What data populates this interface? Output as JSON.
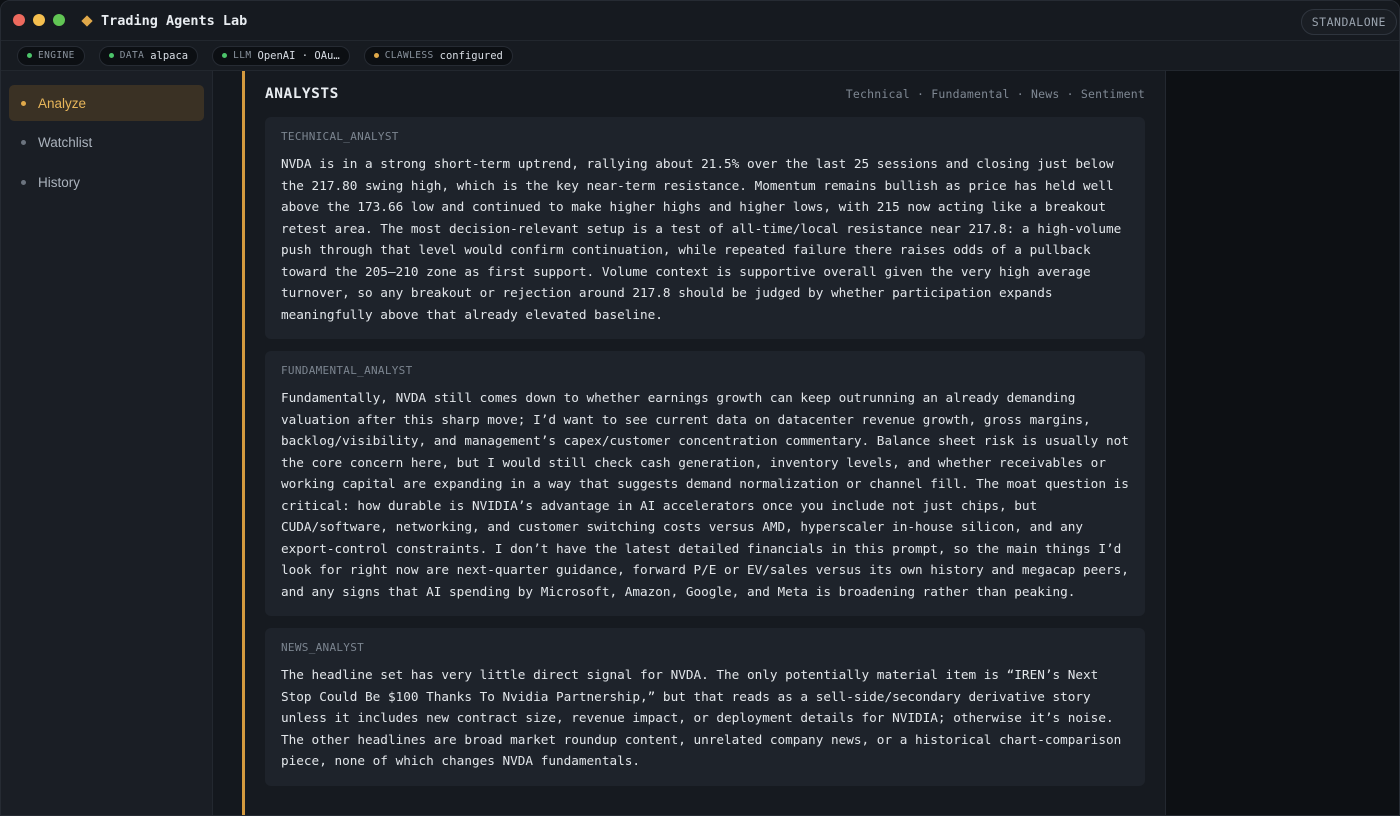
{
  "window": {
    "title": "Trading Agents Lab",
    "mode": "STANDALONE"
  },
  "status": [
    {
      "key": "ENGINE",
      "value": "",
      "dot_color": "#4cc46a"
    },
    {
      "key": "DATA",
      "value": "alpaca",
      "dot_color": "#4cc46a"
    },
    {
      "key": "LLM",
      "value": "OpenAI · OAu…",
      "dot_color": "#4cc46a"
    },
    {
      "key": "CLAWLESS",
      "value": "configured",
      "dot_color": "#e0a94a"
    }
  ],
  "sidebar": {
    "items": [
      {
        "label": "Analyze",
        "active": true
      },
      {
        "label": "Watchlist",
        "active": false
      },
      {
        "label": "History",
        "active": false
      }
    ]
  },
  "main": {
    "title": "ANALYSTS",
    "filters": "Technical · Fundamental · News · Sentiment",
    "cards": [
      {
        "label": "TECHNICAL_ANALYST",
        "text": "NVDA is in a strong short-term uptrend, rallying about 21.5% over the last 25 sessions and closing just below the 217.80 swing high, which is the key near-term resistance. Momentum remains bullish as price has held well above the 173.66 low and continued to make higher highs and higher lows, with 215 now acting like a breakout retest area. The most decision-relevant setup is a test of all-time/local resistance near 217.8: a high-volume push through that level would confirm continuation, while repeated failure there raises odds of a pullback toward the 205–210 zone as first support. Volume context is supportive overall given the very high average turnover, so any breakout or rejection around 217.8 should be judged by whether participation expands meaningfully above that already elevated baseline."
      },
      {
        "label": "FUNDAMENTAL_ANALYST",
        "text": "Fundamentally, NVDA still comes down to whether earnings growth can keep outrunning an already demanding valuation after this sharp move; I’d want to see current data on datacenter revenue growth, gross margins, backlog/visibility, and management’s capex/customer concentration commentary. Balance sheet risk is usually not the core concern here, but I would still check cash generation, inventory levels, and whether receivables or working capital are expanding in a way that suggests demand normalization or channel fill. The moat question is critical: how durable is NVIDIA’s advantage in AI accelerators once you include not just chips, but CUDA/software, networking, and customer switching costs versus AMD, hyperscaler in-house silicon, and any export-control constraints. I don’t have the latest detailed financials in this prompt, so the main things I’d look for right now are next-quarter guidance, forward P/E or EV/sales versus its own history and megacap peers, and any signs that AI spending by Microsoft, Amazon, Google, and Meta is broadening rather than peaking."
      },
      {
        "label": "NEWS_ANALYST",
        "text": "The headline set has very little direct signal for NVDA. The only potentially material item is “IREN’s Next Stop Could Be $100 Thanks To Nvidia Partnership,” but that reads as a sell-side/secondary derivative story unless it includes new contract size, revenue impact, or deployment details for NVIDIA; otherwise it’s noise. The other headlines are broad market roundup content, unrelated company news, or a historical chart-comparison piece, none of which changes NVDA fundamentals."
      }
    ]
  }
}
